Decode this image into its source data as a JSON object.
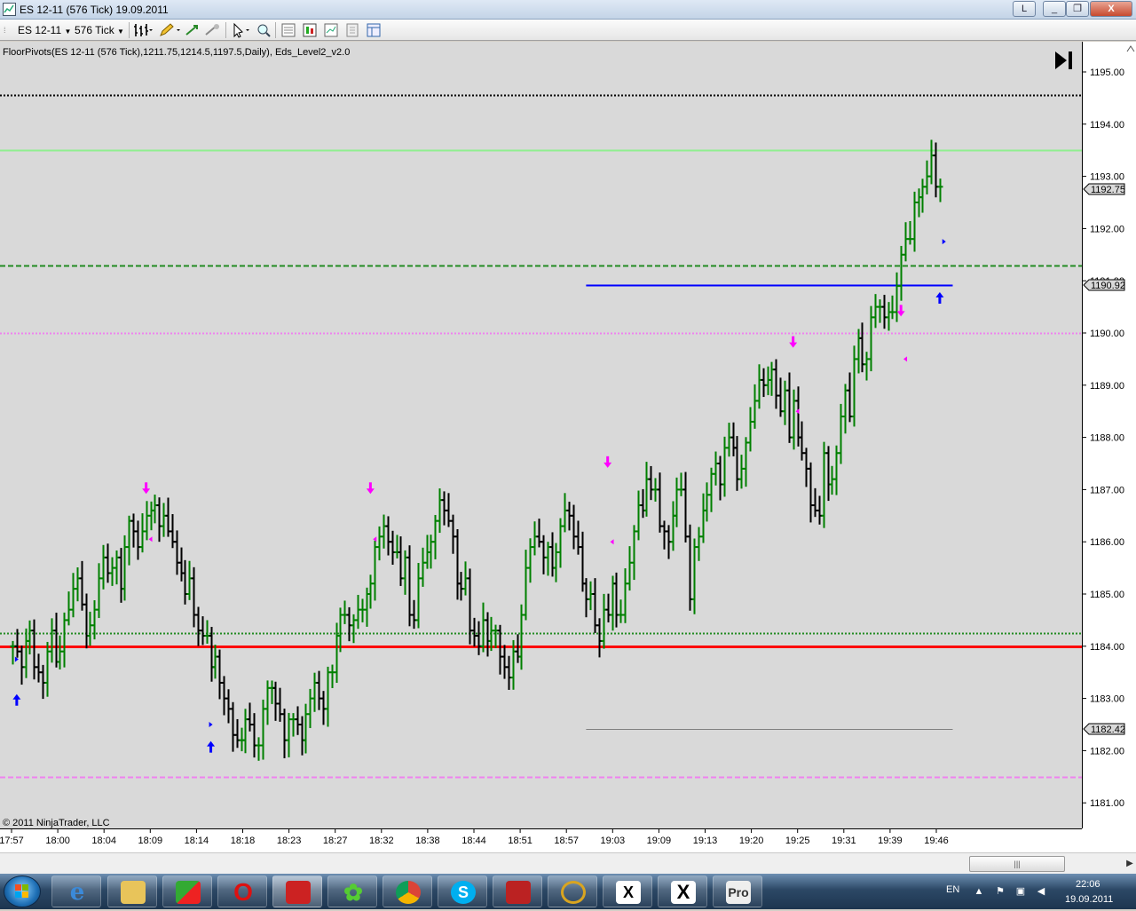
{
  "window": {
    "title": "ES 12-11 (576 Tick)  19.09.2011",
    "lang_badge": "L",
    "minimize_label": "_",
    "restore_label": "❐",
    "close_label": "X"
  },
  "toolbar": {
    "instrument": "ES 12-11",
    "interval": "576 Tick"
  },
  "chart": {
    "indicator_label": "FloorPivots(ES 12-11 (576 Tick),1211.75,1214.5,1197.5,Daily), Eds_Level2_v2.0",
    "copyright": "© 2011 NinjaTrader, LLC",
    "price_axis": [
      "1195.00",
      "1194.00",
      "1193.00",
      "1192.00",
      "1191.00",
      "1190.00",
      "1189.00",
      "1188.00",
      "1187.00",
      "1186.00",
      "1185.00",
      "1184.00",
      "1183.00",
      "1182.00",
      "1181.00"
    ],
    "time_axis": [
      "17:57",
      "18:00",
      "18:04",
      "18:09",
      "18:14",
      "18:18",
      "18:23",
      "18:27",
      "18:32",
      "18:38",
      "18:44",
      "18:51",
      "18:57",
      "19:03",
      "19:09",
      "19:13",
      "19:20",
      "19:25",
      "19:31",
      "19:39",
      "19:46"
    ],
    "price_markers": [
      {
        "label": "1192.75",
        "price": 1192.75
      },
      {
        "label": "1190.92",
        "price": 1190.92
      },
      {
        "label": "1182.42",
        "price": 1182.42
      }
    ],
    "levels": [
      {
        "price": 1194.55,
        "color": "#000000",
        "style": "dotted"
      },
      {
        "price": 1193.5,
        "color": "#90ee90",
        "style": "solid"
      },
      {
        "price": 1191.3,
        "color": "#228b22",
        "style": "dashed"
      },
      {
        "price": 1190.0,
        "color": "#ee82ee",
        "style": "dotted"
      },
      {
        "price": 1184.25,
        "color": "#228b22",
        "style": "dotted"
      },
      {
        "price": 1184.0,
        "color": "#ff0000",
        "style": "solid"
      },
      {
        "price": 1181.5,
        "color": "#ee82ee",
        "style": "dashed"
      }
    ],
    "segments": [
      {
        "from_bar": 133,
        "to_bar": 218,
        "price": 1190.92,
        "color": "#0000ff"
      },
      {
        "from_bar": 133,
        "to_bar": 218,
        "price": 1182.42,
        "color": "#808080"
      }
    ],
    "colors": {
      "up_bar": "#008000",
      "down_bar": "#000000",
      "sell_arrow": "#ff00ff",
      "buy_arrow": "#0000ff"
    }
  },
  "chart_data": {
    "type": "ohlc",
    "instrument": "ES 12-11",
    "interval": "576 Tick",
    "closes": [
      1184.0,
      1183.9,
      1183.6,
      1184.1,
      1184.3,
      1183.6,
      1183.5,
      1183.3,
      1183.9,
      1184.3,
      1183.7,
      1183.9,
      1184.5,
      1184.7,
      1185.1,
      1185.3,
      1184.8,
      1184.2,
      1184.4,
      1184.7,
      1185.3,
      1185.7,
      1185.4,
      1185.5,
      1185.7,
      1185.1,
      1185.9,
      1186.4,
      1186.2,
      1185.9,
      1186.2,
      1186.5,
      1186.6,
      1186.7,
      1186.3,
      1186.5,
      1186.2,
      1186.0,
      1185.6,
      1185.4,
      1185.0,
      1185.3,
      1184.6,
      1184.3,
      1184.2,
      1184.2,
      1183.6,
      1183.8,
      1183.3,
      1183.0,
      1182.8,
      1182.3,
      1182.2,
      1182.2,
      1182.6,
      1182.5,
      1182.1,
      1182.1,
      1182.8,
      1183.2,
      1183.2,
      1182.9,
      1182.7,
      1182.2,
      1182.6,
      1182.6,
      1182.5,
      1182.2,
      1182.7,
      1183.0,
      1183.3,
      1183.0,
      1182.8,
      1183.5,
      1183.5,
      1184.2,
      1184.6,
      1184.6,
      1184.4,
      1184.5,
      1184.7,
      1184.7,
      1185.0,
      1185.2,
      1185.9,
      1186.1,
      1186.3,
      1186.0,
      1185.8,
      1185.8,
      1185.3,
      1185.7,
      1184.6,
      1184.5,
      1185.3,
      1185.6,
      1185.8,
      1186.0,
      1186.4,
      1186.8,
      1186.6,
      1186.4,
      1186.1,
      1185.2,
      1185.1,
      1185.3,
      1184.3,
      1184.2,
      1184.0,
      1184.5,
      1184.1,
      1184.3,
      1184.3,
      1183.8,
      1183.6,
      1183.4,
      1183.9,
      1183.8,
      1184.6,
      1185.5,
      1185.9,
      1186.1,
      1186.0,
      1185.7,
      1185.9,
      1185.5,
      1185.8,
      1186.3,
      1186.6,
      1186.5,
      1186.1,
      1185.9,
      1185.2,
      1184.9,
      1185.0,
      1184.4,
      1184.1,
      1184.7,
      1184.6,
      1185.2,
      1184.6,
      1184.6,
      1185.2,
      1185.6,
      1186.2,
      1186.7,
      1186.6,
      1187.2,
      1187.0,
      1187.0,
      1186.3,
      1186.2,
      1186.0,
      1186.5,
      1187.0,
      1187.0,
      1186.1,
      1184.9,
      1185.9,
      1186.1,
      1186.6,
      1186.9,
      1187.3,
      1187.5,
      1187.1,
      1187.8,
      1188.0,
      1187.8,
      1187.2,
      1187.4,
      1187.9,
      1188.3,
      1188.7,
      1189.1,
      1189.0,
      1189.1,
      1189.3,
      1188.8,
      1188.5,
      1188.9,
      1188.0,
      1188.7,
      1188.0,
      1187.7,
      1187.4,
      1186.7,
      1186.6,
      1186.5,
      1187.7,
      1187.1,
      1187.2,
      1187.7,
      1188.4,
      1188.9,
      1188.4,
      1189.5,
      1189.9,
      1189.4,
      1189.5,
      1190.3,
      1190.5,
      1190.5,
      1190.3,
      1190.4,
      1190.4,
      1190.9,
      1191.5,
      1191.8,
      1191.8,
      1192.5,
      1192.6,
      1192.8,
      1193.0,
      1193.4,
      1192.8,
      1192.8
    ],
    "price_range": [
      1180.6,
      1195.35
    ],
    "annotations": [
      "sell arrows",
      "buy arrows"
    ]
  }
}
